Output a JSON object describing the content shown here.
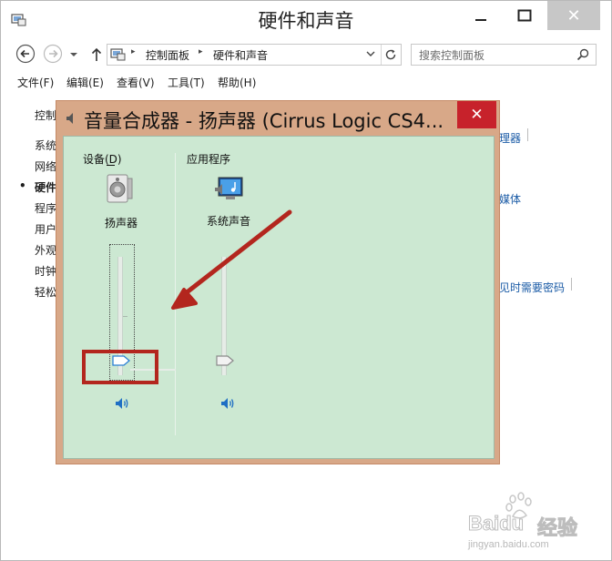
{
  "window": {
    "title": "硬件和声音",
    "close_glyph": "✕"
  },
  "address": {
    "crumbs": [
      "控制面板",
      "硬件和声音"
    ],
    "separator": "▸"
  },
  "search": {
    "placeholder": "搜索控制面板"
  },
  "menu": {
    "items": [
      "文件(F)",
      "编辑(E)",
      "查看(V)",
      "工具(T)",
      "帮助(H)"
    ]
  },
  "control_panel": {
    "left_items": [
      "控制",
      "系统",
      "网络",
      "硬件",
      "程序",
      "用户",
      "外观",
      "时钟",
      "轻松"
    ],
    "active_bullet": "•",
    "right_links": [
      "理器",
      "媒体",
      "见时需要密码"
    ]
  },
  "mixer": {
    "title": "音量合成器 - 扬声器 (Cirrus Logic CS4...",
    "close_glyph": "✕",
    "device_header": "设备(D)",
    "apps_header": "应用程序",
    "device_name": "扬声器",
    "app_name": "系统声音",
    "device_volume_percent": 5,
    "app_volume_percent": 5
  },
  "colors": {
    "dialog_frame": "#d8a888",
    "dialog_body": "#cce8d2",
    "close_red": "#c7222b",
    "annotation_red": "#b3261e"
  },
  "watermark": {
    "brand": "Baidu",
    "suffix": "经验",
    "url": "jingyan.baidu.com"
  }
}
